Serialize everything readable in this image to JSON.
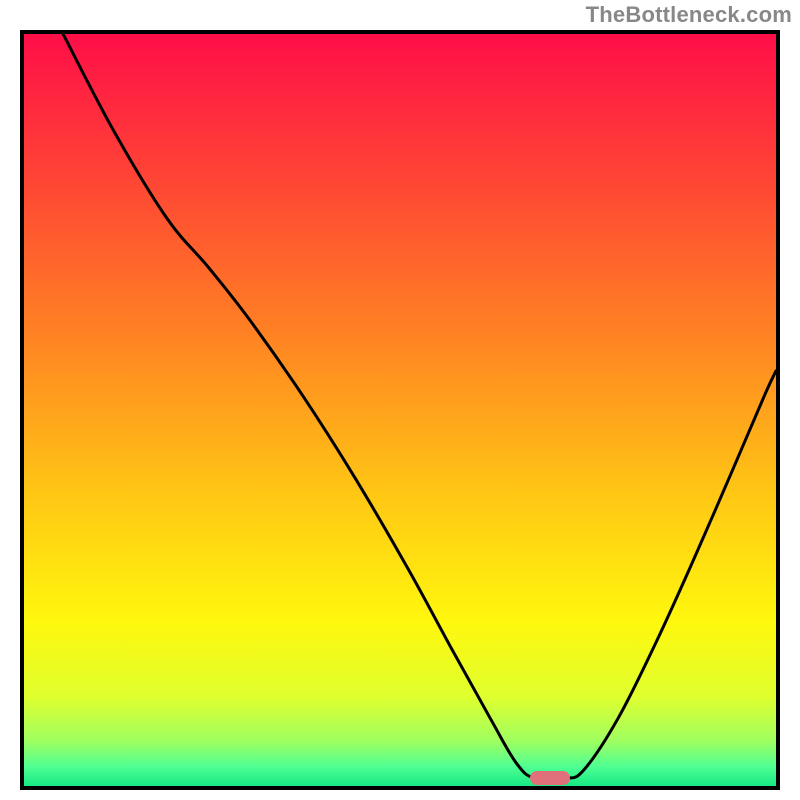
{
  "watermark": "TheBottleneck.com",
  "marker": {
    "x_fraction": 0.7,
    "y_fraction": 0.99,
    "color": "#e0717a"
  },
  "gradient_stops": [
    {
      "offset": 0.0,
      "color": "#ff0e48"
    },
    {
      "offset": 0.2,
      "color": "#ff4734"
    },
    {
      "offset": 0.4,
      "color": "#ff8223"
    },
    {
      "offset": 0.6,
      "color": "#ffc315"
    },
    {
      "offset": 0.78,
      "color": "#fff70d"
    },
    {
      "offset": 0.88,
      "color": "#e0ff2d"
    },
    {
      "offset": 0.94,
      "color": "#a0ff60"
    },
    {
      "offset": 0.975,
      "color": "#4dff93"
    },
    {
      "offset": 1.0,
      "color": "#17e884"
    }
  ],
  "curve_points": [
    {
      "x": 0.052,
      "y": 0.0
    },
    {
      "x": 0.12,
      "y": 0.13
    },
    {
      "x": 0.19,
      "y": 0.245
    },
    {
      "x": 0.245,
      "y": 0.31
    },
    {
      "x": 0.3,
      "y": 0.38
    },
    {
      "x": 0.37,
      "y": 0.48
    },
    {
      "x": 0.44,
      "y": 0.59
    },
    {
      "x": 0.51,
      "y": 0.71
    },
    {
      "x": 0.57,
      "y": 0.82
    },
    {
      "x": 0.62,
      "y": 0.91
    },
    {
      "x": 0.655,
      "y": 0.97
    },
    {
      "x": 0.68,
      "y": 0.99
    },
    {
      "x": 0.72,
      "y": 0.99
    },
    {
      "x": 0.745,
      "y": 0.978
    },
    {
      "x": 0.79,
      "y": 0.91
    },
    {
      "x": 0.84,
      "y": 0.81
    },
    {
      "x": 0.89,
      "y": 0.7
    },
    {
      "x": 0.94,
      "y": 0.585
    },
    {
      "x": 0.985,
      "y": 0.48
    },
    {
      "x": 1.0,
      "y": 0.448
    }
  ],
  "chart_data": {
    "type": "line",
    "title": "",
    "xlabel": "",
    "ylabel": "",
    "xlim": [
      0,
      1
    ],
    "ylim": [
      0,
      1
    ],
    "series": [
      {
        "name": "bottleneck-curve",
        "x": [
          0.052,
          0.12,
          0.19,
          0.245,
          0.3,
          0.37,
          0.44,
          0.51,
          0.57,
          0.62,
          0.655,
          0.68,
          0.72,
          0.745,
          0.79,
          0.84,
          0.89,
          0.94,
          0.985,
          1.0
        ],
        "y": [
          1.0,
          0.87,
          0.755,
          0.69,
          0.62,
          0.52,
          0.41,
          0.29,
          0.18,
          0.09,
          0.03,
          0.01,
          0.01,
          0.022,
          0.09,
          0.19,
          0.3,
          0.415,
          0.52,
          0.552
        ]
      }
    ],
    "annotations": [
      {
        "text": "TheBottleneck.com",
        "position": "top-right"
      }
    ],
    "optimum_marker": {
      "x": 0.7,
      "y": 0.01
    }
  }
}
